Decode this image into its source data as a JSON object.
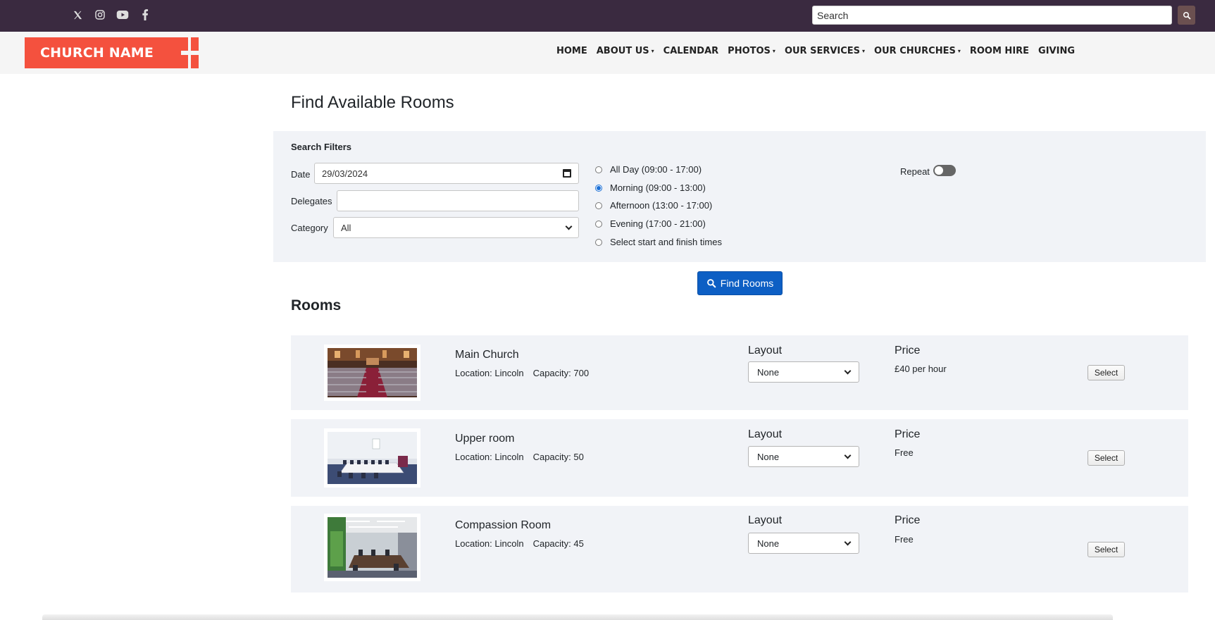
{
  "topbar": {
    "social": [
      {
        "icon": "x-twitter-icon",
        "glyph": "𝕏"
      },
      {
        "icon": "instagram-icon",
        "glyph": ""
      },
      {
        "icon": "youtube-icon",
        "glyph": ""
      },
      {
        "icon": "facebook-icon",
        "glyph": "f"
      }
    ],
    "search_placeholder": "Search"
  },
  "header": {
    "logo_text": "CHURCH NAME",
    "nav": [
      {
        "label": "HOME",
        "dropdown": false
      },
      {
        "label": "ABOUT US",
        "dropdown": true
      },
      {
        "label": "CALENDAR",
        "dropdown": false
      },
      {
        "label": "PHOTOS",
        "dropdown": true
      },
      {
        "label": "OUR SERVICES",
        "dropdown": true
      },
      {
        "label": "OUR CHURCHES",
        "dropdown": true
      },
      {
        "label": "ROOM HIRE",
        "dropdown": false
      },
      {
        "label": "GIVING",
        "dropdown": false
      }
    ],
    "caret": "▾"
  },
  "page": {
    "title": "Find Available Rooms"
  },
  "filters": {
    "title": "Search Filters",
    "date_label": "Date",
    "date_value": "29/03/2024",
    "delegates_label": "Delegates",
    "delegates_value": "",
    "category_label": "Category",
    "category_value": "All",
    "times": [
      {
        "label": "All Day (09:00 - 17:00)",
        "selected": false
      },
      {
        "label": "Morning (09:00 - 13:00)",
        "selected": true
      },
      {
        "label": "Afternoon (13:00 - 17:00)",
        "selected": false
      },
      {
        "label": "Evening (17:00 - 21:00)",
        "selected": false
      },
      {
        "label": "Select start and finish times",
        "selected": false
      }
    ],
    "repeat_label": "Repeat",
    "repeat_on": false
  },
  "find_button": "Find Rooms",
  "rooms_title": "Rooms",
  "rooms": [
    {
      "name": "Main Church",
      "location": "Location: Lincoln",
      "capacity": "Capacity: 700",
      "layout_label": "Layout",
      "layout_value": "None",
      "price_label": "Price",
      "price": "£40 per hour",
      "select": "Select"
    },
    {
      "name": "Upper room",
      "location": "Location: Lincoln",
      "capacity": "Capacity: 50",
      "layout_label": "Layout",
      "layout_value": "None",
      "price_label": "Price",
      "price": "Free",
      "select": "Select"
    },
    {
      "name": "Compassion Room",
      "location": "Location: Lincoln",
      "capacity": "Capacity: 45",
      "layout_label": "Layout",
      "layout_value": "None",
      "price_label": "Price",
      "price": "Free",
      "select": "Select"
    }
  ],
  "colors": {
    "topbar_bg": "#3a2a40",
    "logo_red": "#f4513e",
    "primary_blue": "#0d5fc4",
    "panel_bg": "#f1f3f7"
  }
}
